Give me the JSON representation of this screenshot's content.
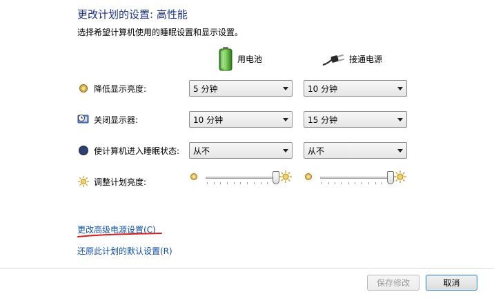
{
  "page": {
    "title": "更改计划的设置: 高性能",
    "subtitle": "选择希望计算机使用的睡眠设置和显示设置。"
  },
  "columns": {
    "battery": "用电池",
    "plugged_in": "接通电源"
  },
  "settings": [
    {
      "label": "降低显示亮度:",
      "icon": "dim-display-icon",
      "battery": "5 分钟",
      "plugged": "10 分钟"
    },
    {
      "label": "关闭显示器:",
      "icon": "display-off-icon",
      "battery": "10 分钟",
      "plugged": "15 分钟"
    },
    {
      "label": "使计算机进入睡眠状态:",
      "icon": "sleep-icon",
      "battery": "从不",
      "plugged": "从不"
    }
  ],
  "brightness": {
    "label": "调整计划亮度:",
    "battery_level": 1.0,
    "plugged_level": 1.0
  },
  "links": {
    "advanced": "更改高级电源设置(C)",
    "restore": "还原此计划的默认设置(R)"
  },
  "buttons": {
    "save": "保存修改",
    "cancel": "取消"
  },
  "colors": {
    "title": "#1e3287",
    "link": "#0f4ea8",
    "annotation": "#d81e1e"
  }
}
